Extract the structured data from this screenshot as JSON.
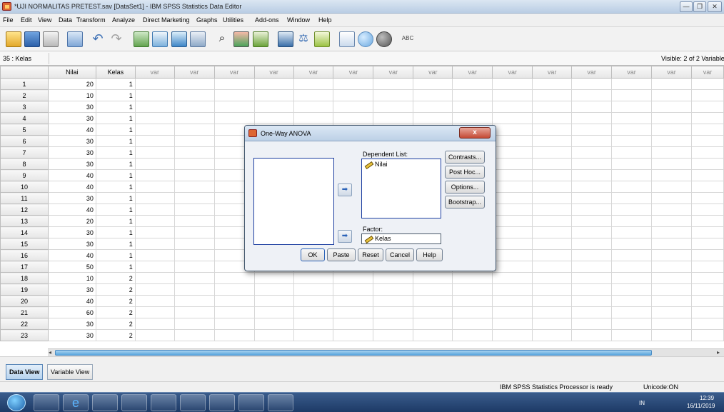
{
  "window": {
    "title": "*UJI NORMALITAS PRETEST.sav [DataSet1] - IBM SPSS Statistics Data Editor",
    "minimize": "—",
    "maximize": "❐",
    "close": "✕"
  },
  "menu": [
    "File",
    "Edit",
    "View",
    "Data",
    "Transform",
    "Analyze",
    "Direct Marketing",
    "Graphs",
    "Utilities",
    "Add-ons",
    "Window",
    "Help"
  ],
  "cell_ref": "35 : Kelas",
  "visible_vars": "Visible: 2 of 2 Variable",
  "grid": {
    "columns": [
      "Nilai",
      "Kelas",
      "var",
      "var",
      "var",
      "var",
      "var",
      "var",
      "var",
      "var",
      "var",
      "var",
      "var",
      "var",
      "var",
      "var",
      "var"
    ],
    "rows": [
      [
        "1",
        "20",
        "1"
      ],
      [
        "2",
        "10",
        "1"
      ],
      [
        "3",
        "30",
        "1"
      ],
      [
        "4",
        "30",
        "1"
      ],
      [
        "5",
        "40",
        "1"
      ],
      [
        "6",
        "30",
        "1"
      ],
      [
        "7",
        "30",
        "1"
      ],
      [
        "8",
        "30",
        "1"
      ],
      [
        "9",
        "40",
        "1"
      ],
      [
        "10",
        "40",
        "1"
      ],
      [
        "11",
        "30",
        "1"
      ],
      [
        "12",
        "40",
        "1"
      ],
      [
        "13",
        "20",
        "1"
      ],
      [
        "14",
        "30",
        "1"
      ],
      [
        "15",
        "30",
        "1"
      ],
      [
        "16",
        "40",
        "1"
      ],
      [
        "17",
        "50",
        "1"
      ],
      [
        "18",
        "10",
        "2"
      ],
      [
        "19",
        "30",
        "2"
      ],
      [
        "20",
        "40",
        "2"
      ],
      [
        "21",
        "60",
        "2"
      ],
      [
        "22",
        "30",
        "2"
      ],
      [
        "23",
        "30",
        "2"
      ]
    ]
  },
  "tabs": {
    "data_view": "Data View",
    "variable_view": "Variable View"
  },
  "status": {
    "processor": "IBM SPSS Statistics Processor is ready",
    "unicode": "Unicode:ON"
  },
  "dialog": {
    "title": "One-Way ANOVA",
    "close": "x",
    "dependent_label": "Dependent List:",
    "dependent_item": "Nilai",
    "factor_label": "Factor:",
    "factor_item": "Kelas",
    "side_buttons": [
      "Contrasts...",
      "Post Hoc...",
      "Options...",
      "Bootstrap..."
    ],
    "bottom_buttons": [
      "OK",
      "Paste",
      "Reset",
      "Cancel",
      "Help"
    ]
  },
  "taskbar": {
    "lang": "IN",
    "time": "12:39",
    "date": "16/11/2019"
  },
  "colors": {
    "accent": "#2b63b8",
    "selection_border": "#1c3ea0",
    "scroll_thumb": "#5aa6de",
    "taskbar": "#1d3a66"
  }
}
